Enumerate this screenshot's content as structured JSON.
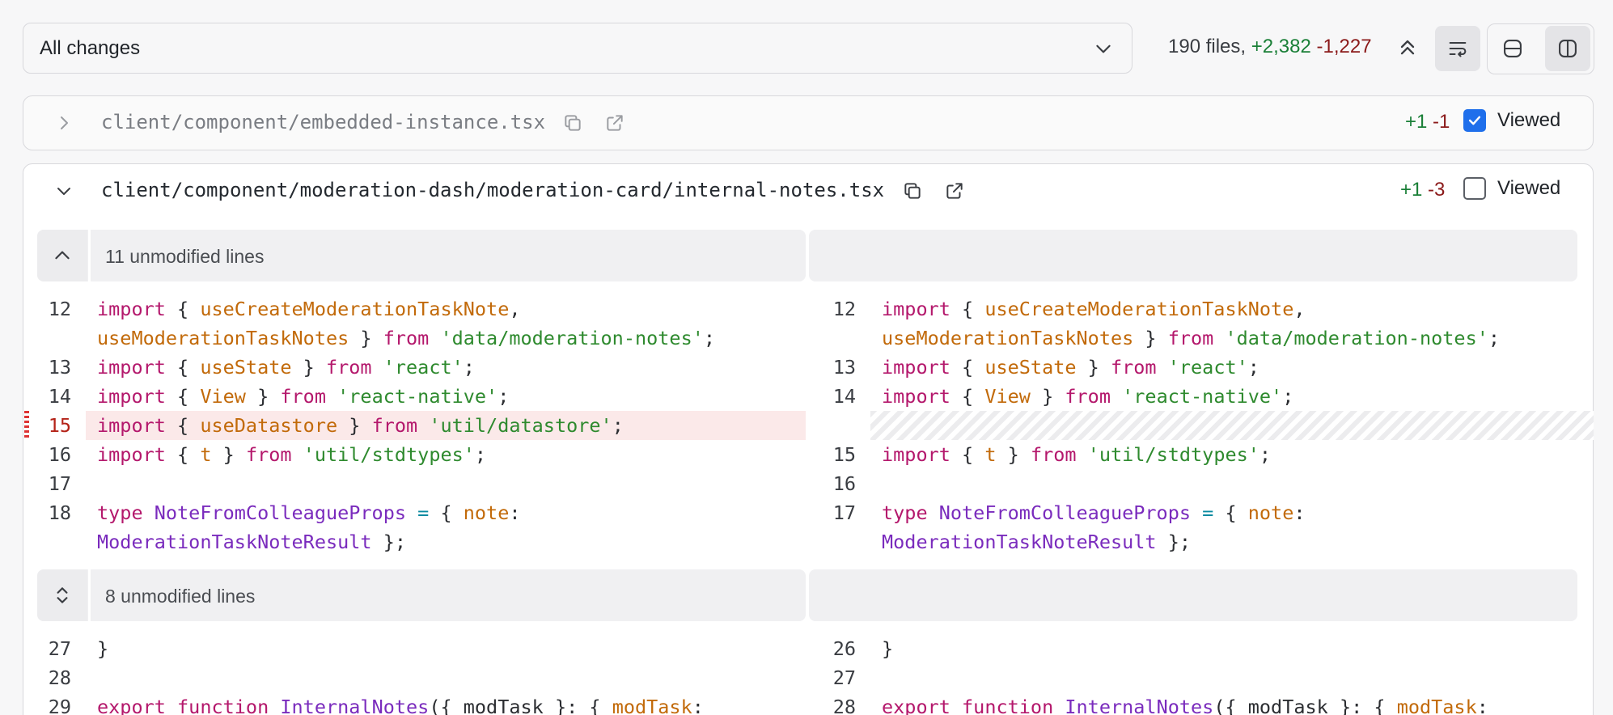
{
  "toolbar": {
    "filter_value": "All changes",
    "files_count": "190 files,",
    "additions": "+2,382",
    "deletions": "-1,227"
  },
  "files": [
    {
      "path": "client/component/embedded-instance.tsx",
      "additions": "+1",
      "deletions": "-1",
      "viewed_label": "Viewed",
      "viewed": true,
      "expanded": false
    },
    {
      "path": "client/component/moderation-dash/moderation-card/internal-notes.tsx",
      "additions": "+1",
      "deletions": "-3",
      "viewed_label": "Viewed",
      "viewed": false,
      "expanded": true
    }
  ],
  "hunks": [
    {
      "label": "11 unmodified lines"
    },
    {
      "label": "8 unmodified lines"
    }
  ],
  "left_lines": [
    "12",
    "13",
    "14",
    "15",
    "16",
    "17",
    "18",
    "27",
    "28",
    "29"
  ],
  "right_lines": [
    "12",
    "13",
    "14",
    "15",
    "16",
    "17",
    "26",
    "27",
    "28"
  ],
  "colors": {
    "addition": "#1a7f37",
    "deletion": "#8b1a1a",
    "deleted_row_bg": "#fbe9e9",
    "keyword": "#b4186c",
    "string": "#2e8a2e",
    "identifier": "#c26a0a",
    "type": "#7a2bbd",
    "checkbox_on": "#1f6feb"
  }
}
